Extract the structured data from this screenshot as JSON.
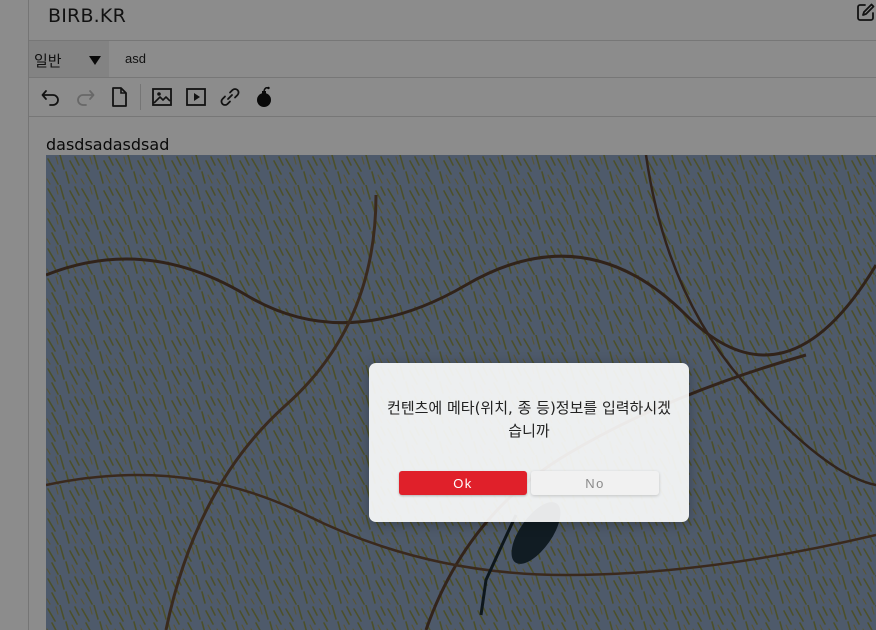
{
  "header": {
    "site_title": "BIRB.KR",
    "edit_icon": "edit-square-icon"
  },
  "editor": {
    "category": {
      "selected": "일반",
      "icon": "triangle-down-icon"
    },
    "title_value": "asd",
    "toolbar": {
      "buttons": [
        {
          "name": "undo",
          "icon": "undo-icon"
        },
        {
          "name": "redo",
          "icon": "redo-icon"
        },
        {
          "name": "document",
          "icon": "document-icon"
        },
        {
          "name": "insert-image",
          "icon": "image-icon"
        },
        {
          "name": "insert-video",
          "icon": "video-play-icon"
        },
        {
          "name": "insert-link",
          "icon": "link-icon"
        },
        {
          "name": "bomb",
          "icon": "bomb-icon"
        }
      ]
    },
    "body_text": "dasdsadasdsad",
    "photo_subject": "bird-in-willow-tree"
  },
  "dialog": {
    "message": "컨텐츠에 메타(위치, 종 등)정보를 입력하시겠습니까",
    "ok_label": "Ok",
    "no_label": "No"
  },
  "colors": {
    "accent_ok": "#e0202a",
    "overlay": "rgba(0,0,0,0.45)",
    "sky": "#8fa4c4",
    "foliage": "#8e9440"
  }
}
